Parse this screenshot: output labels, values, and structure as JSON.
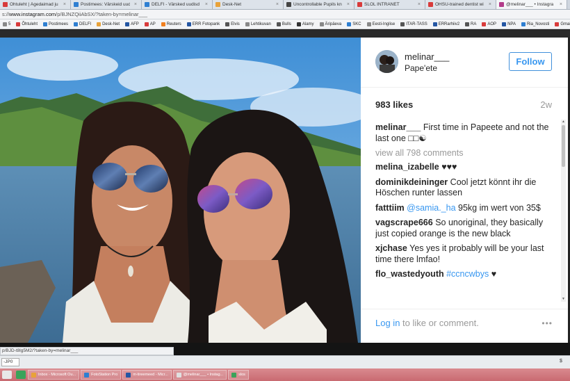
{
  "browser": {
    "tabs": [
      {
        "label": "Õhtuleht | Ägedaimad ju",
        "color": "#d83b3b",
        "active": false
      },
      {
        "label": "Postimees: Värskeid uudis",
        "color": "#2f7fd1",
        "active": false
      },
      {
        "label": "DELFI - Värsked uudisd",
        "color": "#2f7fd1",
        "active": false
      },
      {
        "label": "Desk-Net",
        "color": "#e8a23a",
        "active": false
      },
      {
        "label": "Uncontrollable Pupils kn",
        "color": "#444444",
        "active": false
      },
      {
        "label": "SLOL INTRANET",
        "color": "#d83b3b",
        "active": false
      },
      {
        "label": "OHSU-trained dentist wi",
        "color": "#d83b3b",
        "active": false
      },
      {
        "label": "@melinar___ • Instagra",
        "color": "#b33c8a",
        "active": true
      }
    ],
    "url_host": "www.instagram.com",
    "url_path": "/p/BJNZQiiAbSX/?taken-by=melinar___",
    "url_prefix": "s://",
    "bookmarks": [
      {
        "label": "5",
        "color": "#888888"
      },
      {
        "label": "Õhtuleht",
        "color": "#d83b3b"
      },
      {
        "label": "Postimees",
        "color": "#2f7fd1"
      },
      {
        "label": "DELFI",
        "color": "#2f7fd1"
      },
      {
        "label": "Desk-Net",
        "color": "#e8a23a"
      },
      {
        "label": "AFP",
        "color": "#2456a3"
      },
      {
        "label": "AP",
        "color": "#d83b3b"
      },
      {
        "label": "Reuters",
        "color": "#f08020"
      },
      {
        "label": "ERR Fotopank",
        "color": "#2456a3"
      },
      {
        "label": "Elvis",
        "color": "#555555"
      },
      {
        "label": "Lehtikuvan",
        "color": "#888888"
      },
      {
        "label": "Bulls",
        "color": "#555555"
      },
      {
        "label": "Alamy",
        "color": "#333333"
      },
      {
        "label": "Äripäeva",
        "color": "#888888"
      },
      {
        "label": "SKC",
        "color": "#2f7fd1"
      },
      {
        "label": "Eesti-Inglise",
        "color": "#888888"
      },
      {
        "label": "ITAR-TASS",
        "color": "#555555"
      },
      {
        "label": "ERRarhiiv2",
        "color": "#2456a3"
      },
      {
        "label": "RA",
        "color": "#555555"
      },
      {
        "label": "AOP",
        "color": "#d83b3b"
      },
      {
        "label": "NPA",
        "color": "#2456a3"
      },
      {
        "label": "Ria_Novosti",
        "color": "#2f7fd1"
      },
      {
        "label": "Gmail",
        "color": "#d83b3b"
      }
    ]
  },
  "post": {
    "username": "melinar___",
    "location": "Pape'ete",
    "follow_label": "Follow",
    "likes": "983 likes",
    "age": "2w",
    "caption_user": "melinar___",
    "caption_text": "First time in Papeete and not the last one □□☯",
    "view_all": "view all 798 comments",
    "comments": [
      {
        "user": "melina_izabelle",
        "mention": "",
        "text": "♥♥♥"
      },
      {
        "user": "dominikdeininger",
        "mention": "",
        "text": "Cool jetzt könnt ihr die Höschen runter lassen"
      },
      {
        "user": "fatttiim",
        "mention": "@samia._ha",
        "text": "95kg im wert von 35$"
      },
      {
        "user": "vagscrape666",
        "mention": "",
        "text": "So unoriginal, they basically just copied orange is the new black"
      },
      {
        "user": "xjchase",
        "mention": "",
        "text": "Yes yes it probably will be your last time there lmfao!"
      },
      {
        "user": "flo_wastedyouth",
        "mention": "#ccncwbys",
        "text": "♥"
      }
    ],
    "login_link": "Log in",
    "login_rest": " to like or comment.",
    "more_label": "•••"
  },
  "status": {
    "hover_url": "p/BJD-t8lg5M2/?taken-by=melinar___",
    "find_value": "-JP0"
  },
  "taskbar": {
    "items": [
      {
        "label": "Inbox - Microsoft Ou...",
        "color": "#e8a23a"
      },
      {
        "label": "FotoStation Pro",
        "color": "#2f7fd1"
      },
      {
        "label": "m-tireemeed - Micr...",
        "color": "#2456a3"
      },
      {
        "label": "@melinar___ • Instag...",
        "color": "#e0e0e0"
      },
      {
        "label": "slos",
        "color": "#3aa35a"
      }
    ]
  }
}
